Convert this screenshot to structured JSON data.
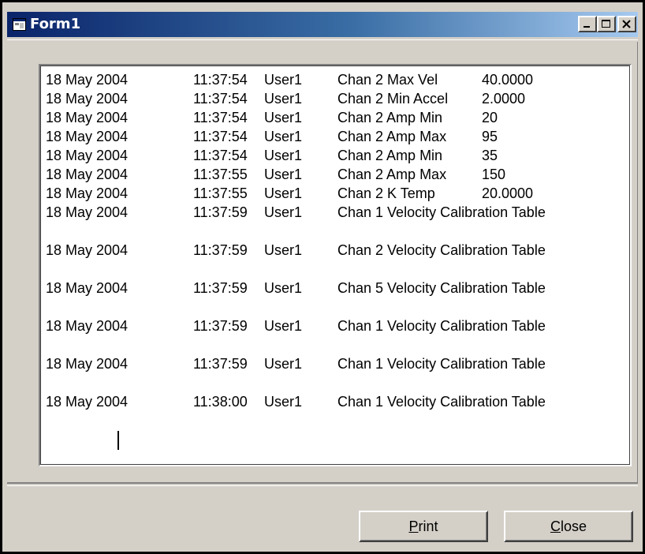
{
  "window": {
    "title": "Form1",
    "minimize_glyph": "minimize-icon",
    "maximize_glyph": "maximize-icon",
    "close_glyph": "close-icon"
  },
  "log": {
    "rows": [
      {
        "date": "18 May 2004",
        "time": "11:37:54",
        "user": "User1",
        "desc": "Chan 2 Max Vel",
        "value": "40.0000"
      },
      {
        "date": "18 May 2004",
        "time": "11:37:54",
        "user": "User1",
        "desc": "Chan 2 Min Accel",
        "value": "2.0000"
      },
      {
        "date": "18 May 2004",
        "time": "11:37:54",
        "user": "User1",
        "desc": "Chan 2 Amp Min",
        "value": "20"
      },
      {
        "date": "18 May 2004",
        "time": "11:37:54",
        "user": "User1",
        "desc": "Chan 2 Amp Max",
        "value": "95"
      },
      {
        "date": "18 May 2004",
        "time": "11:37:54",
        "user": "User1",
        "desc": "Chan 2 Amp Min",
        "value": "35"
      },
      {
        "date": "18 May 2004",
        "time": "11:37:55",
        "user": "User1",
        "desc": "Chan 2 Amp Max",
        "value": "150"
      },
      {
        "date": "18 May 2004",
        "time": "11:37:55",
        "user": "User1",
        "desc": "Chan 2 K Temp",
        "value": "20.0000"
      },
      {
        "date": "18 May 2004",
        "time": "11:37:59",
        "user": "User1",
        "desc": "Chan 1 Velocity Calibration Table",
        "value": ""
      },
      {
        "date": "18 May 2004",
        "time": "11:37:59",
        "user": "User1",
        "desc": "Chan 2 Velocity Calibration Table",
        "value": ""
      },
      {
        "date": "18 May 2004",
        "time": "11:37:59",
        "user": "User1",
        "desc": "Chan 5 Velocity Calibration Table",
        "value": ""
      },
      {
        "date": "18 May 2004",
        "time": "11:37:59",
        "user": "User1",
        "desc": "Chan 1 Velocity Calibration Table",
        "value": ""
      },
      {
        "date": "18 May 2004",
        "time": "11:37:59",
        "user": "User1",
        "desc": "Chan 1 Velocity Calibration Table",
        "value": ""
      },
      {
        "date": "18 May 2004",
        "time": "11:38:00",
        "user": "User1",
        "desc": "Chan 1 Velocity Calibration Table",
        "value": ""
      }
    ]
  },
  "buttons": {
    "print_mnemonic": "P",
    "print_rest": "rint",
    "close_mnemonic": "C",
    "close_rest": "lose"
  },
  "colors": {
    "title_start": "#0a246a",
    "title_end": "#a6caf0",
    "face": "#d4d0c8"
  }
}
